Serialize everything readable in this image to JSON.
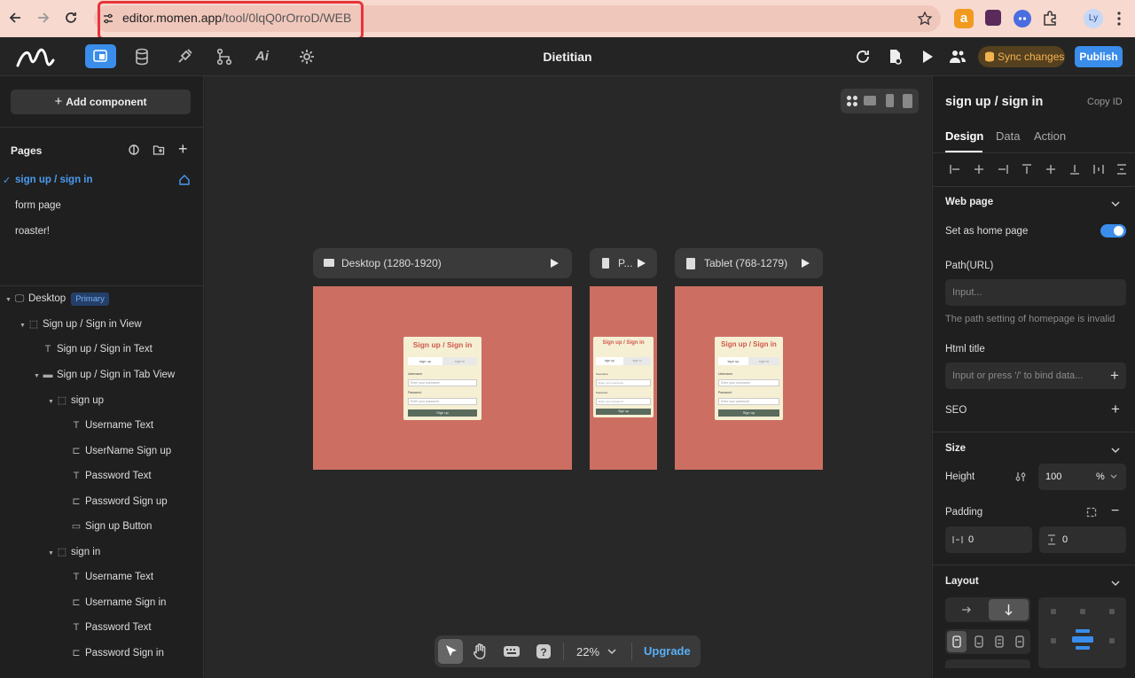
{
  "browser": {
    "url_host": "editor.momen.app",
    "url_path": "/tool/0lqQ0rOrroD/WEB",
    "profile_initials": "Ly"
  },
  "topbar": {
    "project_title": "Dietitian",
    "sync_label": "Sync changes",
    "publish_label": "Publish"
  },
  "left": {
    "add_component": "Add component",
    "pages_heading": "Pages",
    "pages": [
      {
        "label": "sign up / sign in",
        "active": true
      },
      {
        "label": "form page",
        "active": false
      },
      {
        "label": "roaster!",
        "active": false
      }
    ],
    "tree": [
      {
        "label": "Desktop",
        "badge": "Primary",
        "icon": "monitor-icon",
        "indent": 0,
        "caret": true
      },
      {
        "label": "Sign up / Sign in View",
        "icon": "view-icon",
        "indent": 1,
        "caret": true
      },
      {
        "label": "Sign up / Sign in Text",
        "icon": "text-icon",
        "indent": 2,
        "caret": false
      },
      {
        "label": "Sign up / Sign in Tab View",
        "icon": "tab-view-icon",
        "indent": 2,
        "caret": true
      },
      {
        "label": "sign up",
        "icon": "view-icon",
        "indent": 3,
        "caret": true
      },
      {
        "label": "Username Text",
        "icon": "text-icon",
        "indent": 4,
        "caret": false
      },
      {
        "label": "UserName Sign up",
        "icon": "input-icon",
        "indent": 4,
        "caret": false
      },
      {
        "label": "Password Text",
        "icon": "text-icon",
        "indent": 4,
        "caret": false
      },
      {
        "label": "Password Sign up",
        "icon": "input-icon",
        "indent": 4,
        "caret": false
      },
      {
        "label": "Sign up Button",
        "icon": "button-icon",
        "indent": 4,
        "caret": false
      },
      {
        "label": "sign in",
        "icon": "view-icon",
        "indent": 3,
        "caret": true
      },
      {
        "label": "Username Text",
        "icon": "text-icon",
        "indent": 4,
        "caret": false
      },
      {
        "label": "Username Sign in",
        "icon": "input-icon",
        "indent": 4,
        "caret": false
      },
      {
        "label": "Password Text",
        "icon": "text-icon",
        "indent": 4,
        "caret": false
      },
      {
        "label": "Password Sign in",
        "icon": "input-icon",
        "indent": 4,
        "caret": false
      }
    ]
  },
  "canvas": {
    "frames": [
      {
        "label": "Desktop (1280-1920)",
        "icon": "monitor-icon"
      },
      {
        "label": "P...",
        "icon": "phone-icon"
      },
      {
        "label": "Tablet (768-1279)",
        "icon": "tablet-icon"
      }
    ],
    "card": {
      "title": "Sign up / Sign in",
      "tab_signup": "sign up",
      "tab_signin": "sign in",
      "username_label": "Username",
      "username_placeholder": "Enter your username",
      "password_label": "Password",
      "password_placeholder": "Enter your password",
      "button_label": "Sign up"
    },
    "zoom": "22%",
    "upgrade_label": "Upgrade"
  },
  "right": {
    "component_name": "sign up / sign in",
    "copy_id": "Copy ID",
    "tabs": [
      "Design",
      "Data",
      "Action"
    ],
    "active_tab": "Design",
    "web_page_heading": "Web page",
    "home_page_label": "Set as home page",
    "home_page_on": true,
    "path_label": "Path(URL)",
    "path_placeholder": "Input...",
    "path_warning": "The path setting of homepage is invalid",
    "html_title_label": "Html title",
    "html_title_placeholder": "Input or press '/' to bind data...",
    "seo_label": "SEO",
    "size_heading": "Size",
    "height_label": "Height",
    "height_value": "100",
    "height_unit": "%",
    "padding_label": "Padding",
    "padding_h": "0",
    "padding_v": "0",
    "layout_heading": "Layout"
  },
  "colors": {
    "accent": "#3a8dea",
    "frame_bg": "#cc6f62",
    "card_bg": "#f5efd4",
    "card_title": "#cf5a4e",
    "sync_text": "#f3b34e"
  }
}
